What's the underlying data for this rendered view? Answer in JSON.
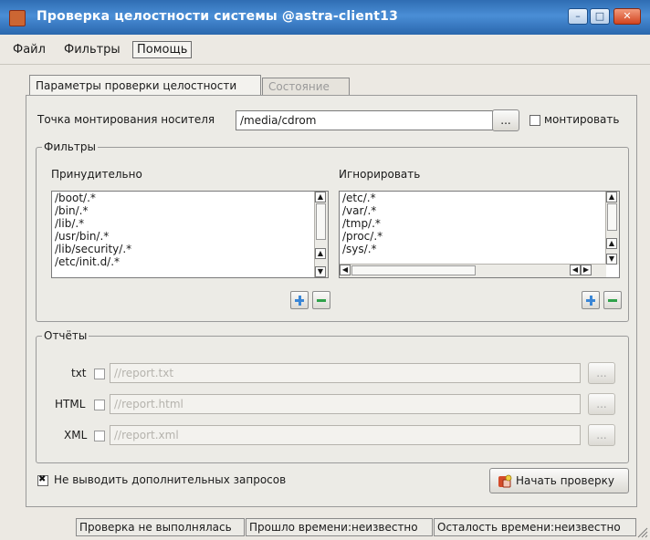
{
  "window": {
    "title": "Проверка целостности системы @astra-client13",
    "controls": {
      "minimize": "–",
      "maximize": "□",
      "close": "✕"
    }
  },
  "menu": {
    "items": [
      "Файл",
      "Фильтры",
      "Помощь"
    ]
  },
  "tabs": {
    "items": [
      "Параметры проверки целостности",
      "Состояние"
    ],
    "active_index": 0
  },
  "mount": {
    "label": "Точка монтирования носителя",
    "value": "/media/cdrom",
    "browse_label": "...",
    "mount_checkbox_label": "монтировать",
    "mount_checked": false
  },
  "filters": {
    "group_title": "Фильтры",
    "force": {
      "label": "Принудительно",
      "items": [
        "/boot/.*",
        "/bin/.*",
        "/lib/.*",
        "/usr/bin/.*",
        "/lib/security/.*",
        "/etc/init.d/.*"
      ]
    },
    "ignore": {
      "label": "Игнорировать",
      "items": [
        "/etc/.*",
        "/var/.*",
        "/tmp/.*",
        "/proc/.*",
        "/sys/.*"
      ]
    }
  },
  "reports": {
    "group_title": "Отчёты",
    "rows": [
      {
        "label": "txt",
        "placeholder": "//report.txt",
        "checked": false,
        "browse_label": "..."
      },
      {
        "label": "HTML",
        "placeholder": "//report.html",
        "checked": false,
        "browse_label": "..."
      },
      {
        "label": "XML",
        "placeholder": "//report.xml",
        "checked": false,
        "browse_label": "..."
      }
    ]
  },
  "options": {
    "no_extra_prompts_label": "Не выводить дополнительных запросов",
    "no_extra_prompts_checked": true
  },
  "actions": {
    "start_check_label": "Начать проверку"
  },
  "status": {
    "check_status": "Проверка не выполнялась",
    "elapsed": "Прошло времени:неизвестно",
    "remaining": "Осталость времени:неизвестно"
  }
}
